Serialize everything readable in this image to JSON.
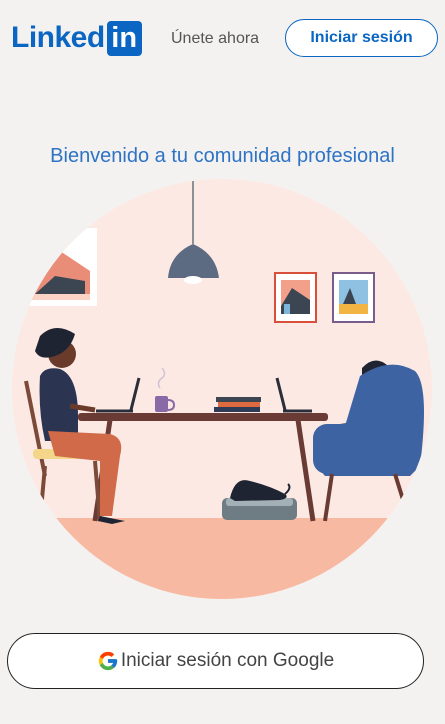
{
  "header": {
    "logo_text": "Linked",
    "logo_box": "in",
    "join_label": "Únete ahora",
    "signin_label": "Iniciar sesión"
  },
  "main": {
    "welcome_title": "Bienvenido a tu comunidad profesional"
  },
  "google_button": {
    "label": "Iniciar sesión con Google",
    "icon": "google-g-icon"
  },
  "colors": {
    "brand": "#0a66c2",
    "background": "#f3f2f0",
    "hero_circle": "#fde9e4"
  }
}
